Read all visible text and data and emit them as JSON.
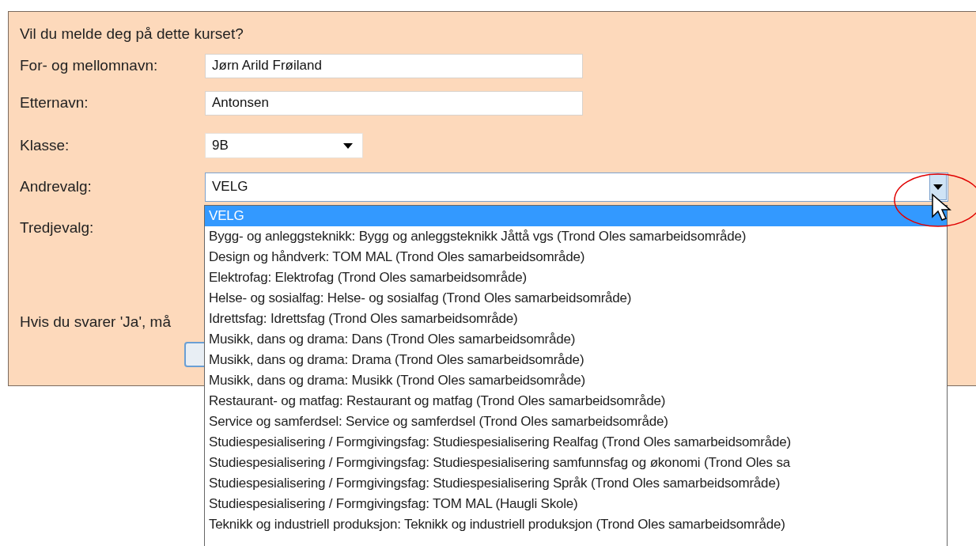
{
  "form": {
    "question": "Vil du melde deg på dette kurset?",
    "fields": [
      {
        "kind": "text",
        "label": "For- og mellomnavn:",
        "value": "Jørn Arild Frøiland"
      },
      {
        "kind": "text",
        "label": "Etternavn:",
        "value": "Antonsen"
      },
      {
        "kind": "select",
        "label": "Klasse:",
        "value": "9B",
        "expanded": false
      },
      {
        "kind": "select",
        "label": "Andrevalg:",
        "value": "VELG",
        "expanded": true
      },
      {
        "kind": "label",
        "label": "Tredjevalg:"
      }
    ],
    "note": "Hvis du svarer 'Ja', må"
  },
  "dropdown": {
    "options": [
      {
        "label": "VELG",
        "selected": true
      },
      {
        "label": "Bygg- og anleggsteknikk: Bygg og anleggsteknikk Jåttå vgs (Trond Oles samarbeidsområde)",
        "selected": false
      },
      {
        "label": "Design og håndverk: TOM MAL (Trond Oles samarbeidsområde)",
        "selected": false
      },
      {
        "label": "Elektrofag: Elektrofag (Trond Oles samarbeidsområde)",
        "selected": false
      },
      {
        "label": "Helse- og sosialfag: Helse- og sosialfag (Trond Oles samarbeidsområde)",
        "selected": false
      },
      {
        "label": "Idrettsfag: Idrettsfag (Trond Oles samarbeidsområde)",
        "selected": false
      },
      {
        "label": "Musikk, dans og drama: Dans (Trond Oles samarbeidsområde)",
        "selected": false
      },
      {
        "label": "Musikk, dans og drama: Drama (Trond Oles samarbeidsområde)",
        "selected": false
      },
      {
        "label": "Musikk, dans og drama: Musikk (Trond Oles samarbeidsområde)",
        "selected": false
      },
      {
        "label": "Restaurant- og matfag: Restaurant og matfag (Trond Oles samarbeidsområde)",
        "selected": false
      },
      {
        "label": "Service og samferdsel: Service og samferdsel (Trond Oles samarbeidsområde)",
        "selected": false
      },
      {
        "label": "Studiespesialisering / Formgivingsfag: Studiespesialisering Realfag (Trond Oles samarbeidsområde)",
        "selected": false
      },
      {
        "label": "Studiespesialisering / Formgivingsfag: Studiespesialisering samfunnsfag og økonomi (Trond Oles sa",
        "selected": false
      },
      {
        "label": "Studiespesialisering / Formgivingsfag: Studiespesialisering Språk (Trond Oles samarbeidsområde)",
        "selected": false
      },
      {
        "label": "Studiespesialisering / Formgivingsfag: TOM MAL (Haugli Skole)",
        "selected": false
      },
      {
        "label": "Teknikk og industriell produksjon: Teknikk og industriell produksjon (Trond Oles samarbeidsområde)",
        "selected": false
      }
    ]
  }
}
